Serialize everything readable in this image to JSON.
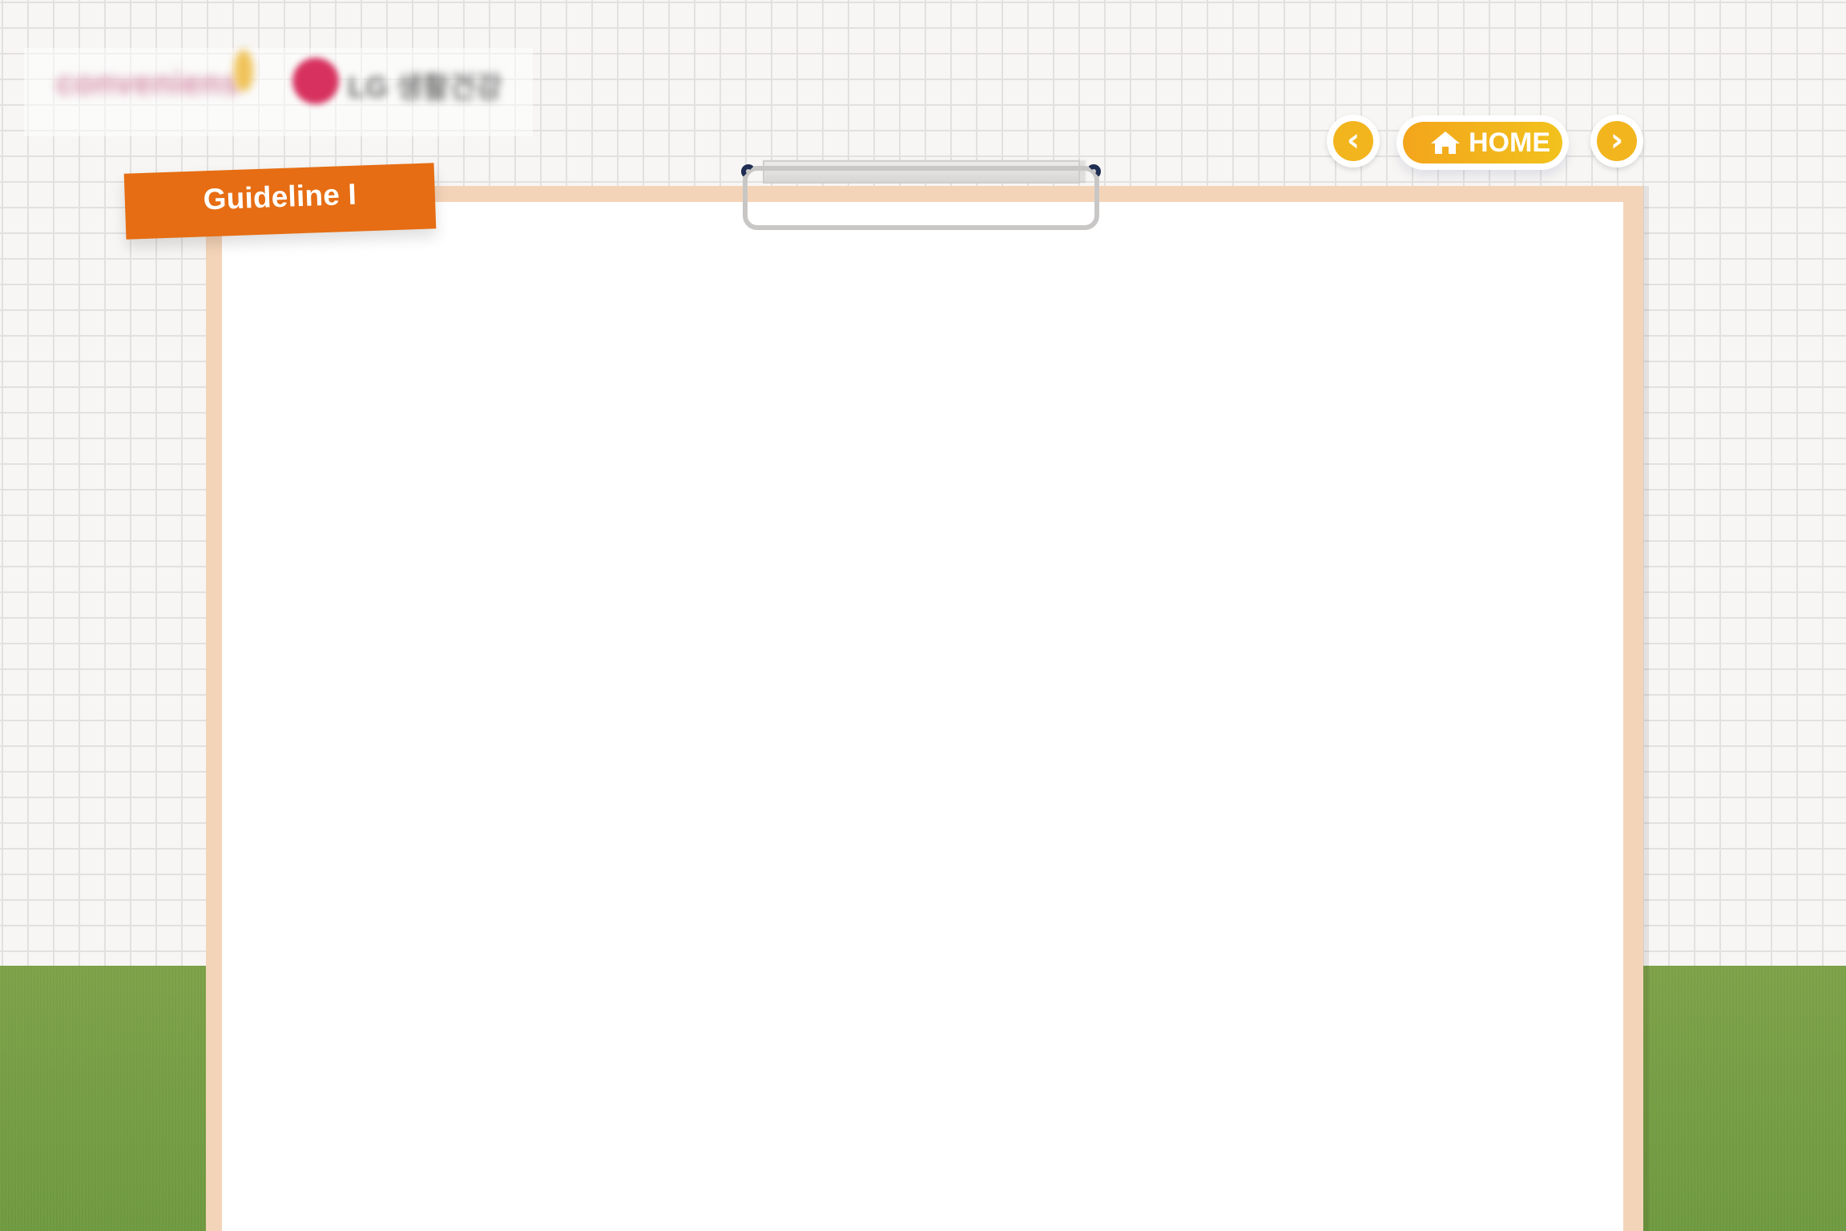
{
  "branding": {
    "logo_text": "conveniens",
    "partner_logo_text": "LG 생활건강"
  },
  "guideline": {
    "label": "Guideline I"
  },
  "navigation": {
    "previous_label": "‹",
    "home_label": "HOME",
    "next_label": "›"
  },
  "board": {
    "title": "",
    "footnotes": [
      "",
      "",
      "",
      ""
    ]
  },
  "colors": {
    "accent_orange": "#e66d13",
    "nav_yellow": "#f2b51d",
    "grass_green": "#7da248",
    "frame_peach": "#f4d4b9",
    "blurred_title_green": "#79aa45"
  },
  "icons": {
    "previous": "chevron-left-icon",
    "home": "home-icon",
    "next": "chevron-right-icon"
  }
}
